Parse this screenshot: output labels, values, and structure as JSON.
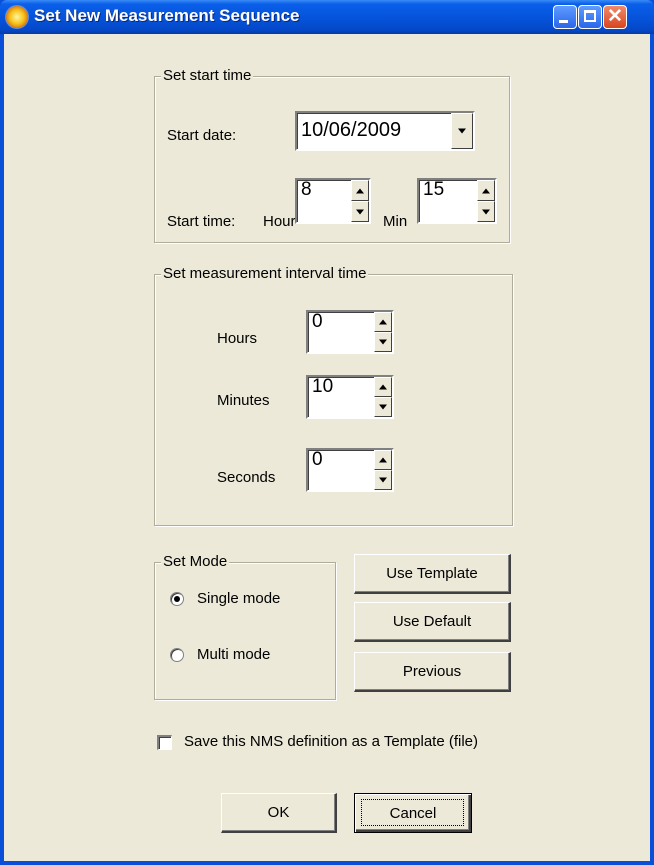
{
  "window": {
    "title": "Set New Measurement Sequence",
    "close_glyph": "✕",
    "icon": "app-sun-icon",
    "title_color": "#0654dc",
    "face_color": "#ece9d8"
  },
  "start_time_group": {
    "label": "Set start time",
    "start_date_label": "Start date:",
    "start_date_value": "10/06/2009",
    "start_time_label": "Start time:",
    "hour_label": "Hour",
    "hour_value": "8",
    "min_label": "Min",
    "min_value": "15"
  },
  "interval_group": {
    "label": "Set measurement interval time",
    "hours_label": "Hours",
    "hours_value": "0",
    "minutes_label": "Minutes",
    "minutes_value": "10",
    "seconds_label": "Seconds",
    "seconds_value": "0"
  },
  "mode_group": {
    "label": "Set Mode",
    "single_label": "Single mode",
    "multi_label": "Multi mode",
    "selected": "Single mode"
  },
  "side_buttons": {
    "use_template": "Use Template",
    "use_default": "Use Default",
    "previous": "Previous"
  },
  "save_template": {
    "label": "Save this NMS definition as a Template (file)",
    "checked": false
  },
  "footer": {
    "ok": "OK",
    "cancel": "Cancel"
  }
}
